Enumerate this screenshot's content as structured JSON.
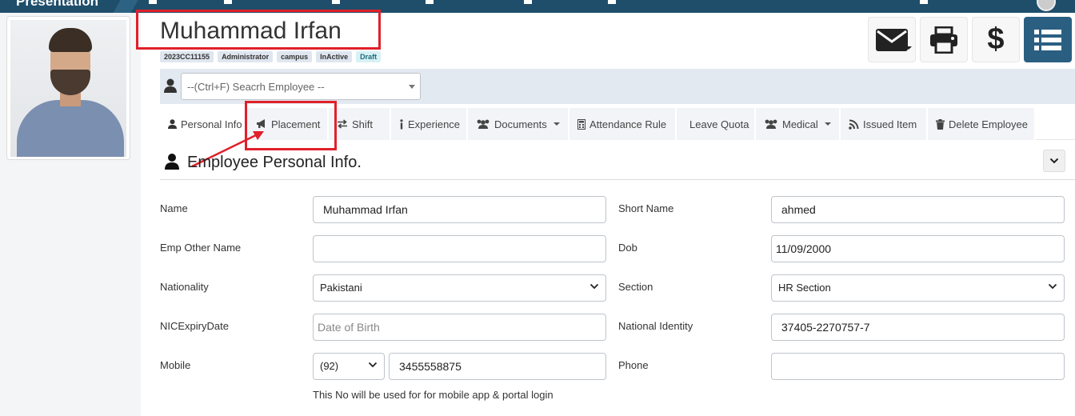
{
  "topbar": {
    "brand": "Presentation"
  },
  "employee": {
    "name": "Muhammad Irfan",
    "badges": [
      "2023CC11155",
      "Administrator",
      "campus",
      "InActive",
      "Draft"
    ]
  },
  "actions": [
    "mail-icon",
    "print-icon",
    "dollar-icon",
    "list-icon"
  ],
  "actions_labels": {
    "dollar": "$"
  },
  "search": {
    "placeholder": "--(Ctrl+F) Seacrh Employee --"
  },
  "tabs": [
    {
      "label": "Personal Info",
      "icon": "user-icon"
    },
    {
      "label": "Placement",
      "icon": "bullhorn-icon"
    },
    {
      "label": "Shift",
      "icon": "exchange-icon"
    },
    {
      "label": "Experience",
      "icon": "info-icon"
    },
    {
      "label": "Documents",
      "icon": "users-icon"
    },
    {
      "label": "Attendance Rule",
      "icon": "calculator-icon"
    },
    {
      "label": "Leave Quota",
      "icon": ""
    },
    {
      "label": "Medical",
      "icon": "users-icon"
    },
    {
      "label": "Issued Item",
      "icon": "rss-icon"
    },
    {
      "label": "Delete Employee",
      "icon": "trash-icon"
    }
  ],
  "section": {
    "title": "Employee Personal Info."
  },
  "form": {
    "name": {
      "label": "Name",
      "value": "Muhammad Irfan"
    },
    "short_name": {
      "label": "Short Name",
      "value": "ahmed"
    },
    "other_name": {
      "label": "Emp Other Name",
      "value": ""
    },
    "dob": {
      "label": "Dob",
      "value": "11/09/2000"
    },
    "nationality": {
      "label": "Nationality",
      "value": "Pakistani"
    },
    "section": {
      "label": "Section",
      "value": "HR Section"
    },
    "nic_expiry": {
      "label": "NICExpiryDate",
      "placeholder": "Date of Birth"
    },
    "national_identity": {
      "label": "National Identity",
      "value": "37405-2270757-7"
    },
    "mobile": {
      "label": "Mobile",
      "code": "(92)",
      "value": "3455558875"
    },
    "phone": {
      "label": "Phone",
      "value": ""
    },
    "mobile_help": "This No will be used for for mobile app & portal login"
  }
}
